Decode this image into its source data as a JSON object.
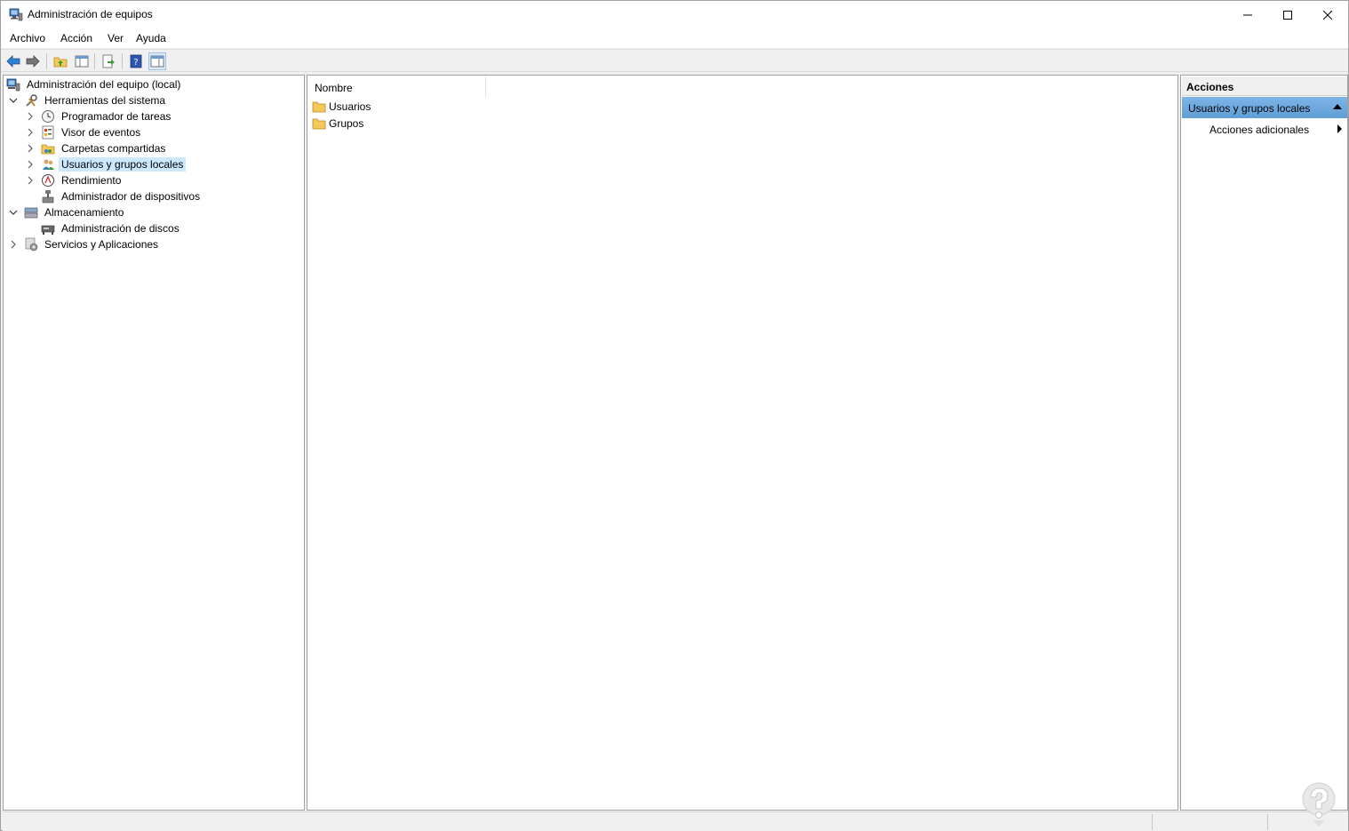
{
  "window": {
    "title": "Administración de equipos",
    "icon": "computer-management-icon"
  },
  "menu": [
    "Archivo",
    "Acción",
    "Ver",
    "Ayuda"
  ],
  "toolbar": {
    "buttons": [
      "back-arrow-icon",
      "forward-arrow-icon",
      "up-folder-icon",
      "show-hide-tree-icon",
      "export-list-icon",
      "help-icon",
      "show-hide-action-pane-icon"
    ]
  },
  "tree": {
    "root": "Administración del equipo (local)",
    "items": [
      {
        "label": "Herramientas del sistema",
        "icon": "tools-icon",
        "expanded": true
      },
      {
        "label": "Programador de tareas",
        "icon": "clock-icon"
      },
      {
        "label": "Visor de eventos",
        "icon": "event-viewer-icon"
      },
      {
        "label": "Carpetas compartidas",
        "icon": "shared-folder-icon"
      },
      {
        "label": "Usuarios y grupos locales",
        "icon": "users-icon",
        "selected": true
      },
      {
        "label": "Rendimiento",
        "icon": "performance-icon"
      },
      {
        "label": "Administrador de dispositivos",
        "icon": "device-manager-icon"
      },
      {
        "label": "Almacenamiento",
        "icon": "storage-icon",
        "expanded": true
      },
      {
        "label": "Administración de discos",
        "icon": "disk-icon"
      },
      {
        "label": "Servicios y Aplicaciones",
        "icon": "services-icon"
      }
    ]
  },
  "list": {
    "column": "Nombre",
    "rows": [
      "Usuarios",
      "Grupos"
    ]
  },
  "actions": {
    "header": "Acciones",
    "section": "Usuarios y grupos locales",
    "item": "Acciones adicionales"
  },
  "colors": {
    "selection": "#cce8ff",
    "action_section": "#6fa8dc",
    "folder": "#f5c85a"
  }
}
